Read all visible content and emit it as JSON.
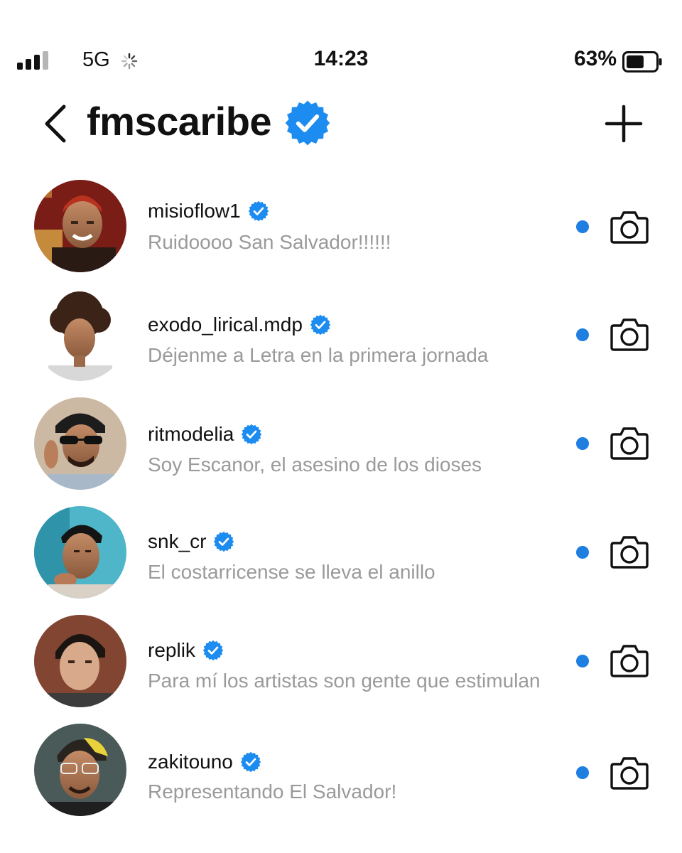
{
  "status_bar": {
    "network": "5G",
    "time": "14:23",
    "battery": "63%",
    "battery_level": 0.63
  },
  "header": {
    "title": "fmscaribe",
    "back_icon": "chevron-left-icon",
    "new_message_icon": "plus-icon",
    "verified_icon": "verified-badge-icon"
  },
  "colors": {
    "verified_blue": "#1d8cf0",
    "unread_dot": "#1e7fe0",
    "preview_gray": "#9a9a9a"
  },
  "threads": [
    {
      "username": "misioflow1",
      "verified": true,
      "preview": "Ruidoooo San Salvador!!!!!!",
      "unread": true
    },
    {
      "username": "exodo_lirical.mdp",
      "verified": true,
      "preview": "Déjenme a Letra en la primera jornada",
      "unread": true
    },
    {
      "username": "ritmodelia",
      "verified": true,
      "preview": "Soy Escanor, el asesino de los dioses",
      "unread": true
    },
    {
      "username": "snk_cr",
      "verified": true,
      "preview": "El costarricense se lleva el anillo",
      "unread": true
    },
    {
      "username": "replik",
      "verified": true,
      "preview": "Para mí los artistas son gente que estimulan",
      "unread": true
    },
    {
      "username": "zakitouno",
      "verified": true,
      "preview": "Representando El Salvador!",
      "unread": true
    }
  ]
}
